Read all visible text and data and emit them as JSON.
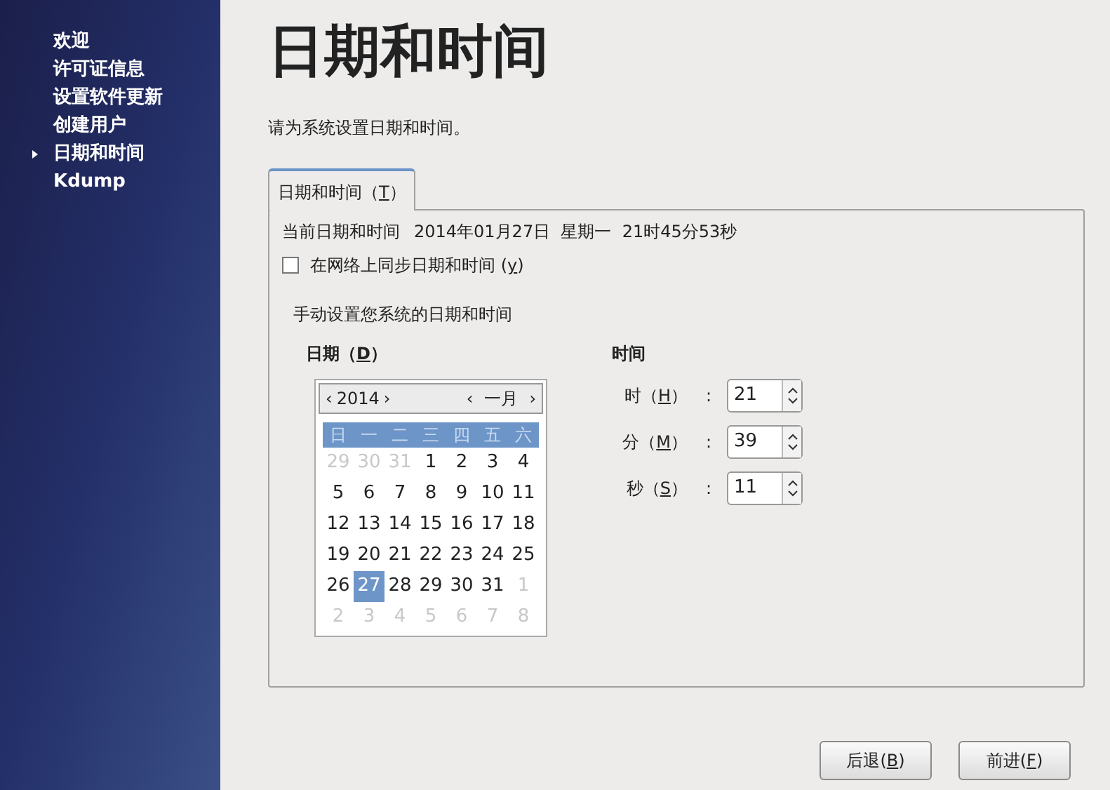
{
  "sidebar": {
    "items": [
      {
        "label": "欢迎",
        "selected": false
      },
      {
        "label": "许可证信息",
        "selected": false
      },
      {
        "label": "设置软件更新",
        "selected": false
      },
      {
        "label": "创建用户",
        "selected": false
      },
      {
        "label": "日期和时间",
        "selected": true
      },
      {
        "label": "Kdump",
        "selected": false
      }
    ]
  },
  "title": "日期和时间",
  "subtitle": "请为系统设置日期和时间。",
  "tabs": [
    {
      "before": "日期和时间（",
      "key": "T",
      "after": "）",
      "selected": true
    }
  ],
  "current": {
    "label": "当前日期和时间",
    "value": "2014年01月27日  星期一  21时45分53秒"
  },
  "sync": {
    "before": "在网络上同步日期和时间 (",
    "key": "y",
    "after": ")",
    "checked": false
  },
  "manual_label": "手动设置您系统的日期和时间",
  "date": {
    "heading": {
      "before": "日期（",
      "key": "D",
      "after": "）"
    },
    "year": {
      "prev": "‹",
      "value": "2014",
      "next": "›"
    },
    "month": {
      "prev": "‹",
      "value": "一月",
      "next": "›"
    },
    "weekdays": [
      "日",
      "一",
      "二",
      "三",
      "四",
      "五",
      "六"
    ],
    "days": [
      {
        "label": "29",
        "in_month": false,
        "selected": false
      },
      {
        "label": "30",
        "in_month": false,
        "selected": false
      },
      {
        "label": "31",
        "in_month": false,
        "selected": false
      },
      {
        "label": "1",
        "in_month": true,
        "selected": false
      },
      {
        "label": "2",
        "in_month": true,
        "selected": false
      },
      {
        "label": "3",
        "in_month": true,
        "selected": false
      },
      {
        "label": "4",
        "in_month": true,
        "selected": false
      },
      {
        "label": "5",
        "in_month": true,
        "selected": false
      },
      {
        "label": "6",
        "in_month": true,
        "selected": false
      },
      {
        "label": "7",
        "in_month": true,
        "selected": false
      },
      {
        "label": "8",
        "in_month": true,
        "selected": false
      },
      {
        "label": "9",
        "in_month": true,
        "selected": false
      },
      {
        "label": "10",
        "in_month": true,
        "selected": false
      },
      {
        "label": "11",
        "in_month": true,
        "selected": false
      },
      {
        "label": "12",
        "in_month": true,
        "selected": false
      },
      {
        "label": "13",
        "in_month": true,
        "selected": false
      },
      {
        "label": "14",
        "in_month": true,
        "selected": false
      },
      {
        "label": "15",
        "in_month": true,
        "selected": false
      },
      {
        "label": "16",
        "in_month": true,
        "selected": false
      },
      {
        "label": "17",
        "in_month": true,
        "selected": false
      },
      {
        "label": "18",
        "in_month": true,
        "selected": false
      },
      {
        "label": "19",
        "in_month": true,
        "selected": false
      },
      {
        "label": "20",
        "in_month": true,
        "selected": false
      },
      {
        "label": "21",
        "in_month": true,
        "selected": false
      },
      {
        "label": "22",
        "in_month": true,
        "selected": false
      },
      {
        "label": "23",
        "in_month": true,
        "selected": false
      },
      {
        "label": "24",
        "in_month": true,
        "selected": false
      },
      {
        "label": "25",
        "in_month": true,
        "selected": false
      },
      {
        "label": "26",
        "in_month": true,
        "selected": false
      },
      {
        "label": "27",
        "in_month": true,
        "selected": true
      },
      {
        "label": "28",
        "in_month": true,
        "selected": false
      },
      {
        "label": "29",
        "in_month": true,
        "selected": false
      },
      {
        "label": "30",
        "in_month": true,
        "selected": false
      },
      {
        "label": "31",
        "in_month": true,
        "selected": false
      },
      {
        "label": "1",
        "in_month": false,
        "selected": false
      },
      {
        "label": "2",
        "in_month": false,
        "selected": false
      },
      {
        "label": "3",
        "in_month": false,
        "selected": false
      },
      {
        "label": "4",
        "in_month": false,
        "selected": false
      },
      {
        "label": "5",
        "in_month": false,
        "selected": false
      },
      {
        "label": "6",
        "in_month": false,
        "selected": false
      },
      {
        "label": "7",
        "in_month": false,
        "selected": false
      },
      {
        "label": "8",
        "in_month": false,
        "selected": false
      }
    ]
  },
  "time": {
    "heading": "时间",
    "fields": [
      {
        "before": "时（",
        "key": "H",
        "after": "）",
        "colon": ":",
        "value": "21"
      },
      {
        "before": "分（",
        "key": "M",
        "after": "）",
        "colon": ":",
        "value": "39"
      },
      {
        "before": "秒（",
        "key": "S",
        "after": "）",
        "colon": ":",
        "value": "11"
      }
    ]
  },
  "buttons": [
    {
      "before": "后退(",
      "key": "B",
      "after": ")"
    },
    {
      "before": "前进(",
      "key": "F",
      "after": ")"
    }
  ]
}
